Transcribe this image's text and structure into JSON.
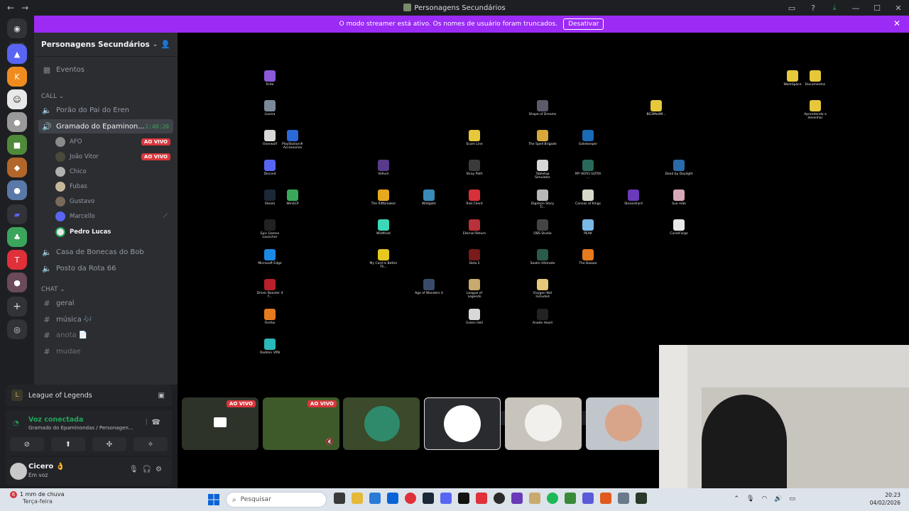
{
  "window": {
    "title": "Personagens Secundários",
    "back": "←",
    "forward": "→"
  },
  "streamer_banner": {
    "text": "O modo streamer está ativo. Os nomes de usuário foram truncados.",
    "button": "Desativar"
  },
  "guild": {
    "name": "Personagens Secundários"
  },
  "channels": {
    "events": "Eventos",
    "call_category": "CALL",
    "voice": [
      {
        "name": "Porão do Pai do Eren"
      },
      {
        "name": "Gramado do Epaminon...",
        "time": "1:40:20",
        "active": true
      },
      {
        "name": "Casa de Bonecas do Bob"
      },
      {
        "name": "Posto da Rota 66"
      }
    ],
    "members": [
      {
        "name": "AFO",
        "badge": "AO VIVO"
      },
      {
        "name": "João Vitor",
        "badge": "AO VIVO"
      },
      {
        "name": "Chico"
      },
      {
        "name": "Fubas"
      },
      {
        "name": "Gustavo"
      },
      {
        "name": "Marcello"
      },
      {
        "name": "Pedro Lucas"
      }
    ],
    "chat_category": "CHAT",
    "text": [
      {
        "name": "geral"
      },
      {
        "name": "música 🎶"
      },
      {
        "name": "anota 📄"
      },
      {
        "name": "mudae"
      }
    ]
  },
  "activity": {
    "game": "League of Legends"
  },
  "voice_panel": {
    "status": "Voz conectada",
    "location": "Gramado do Epaminondas / Personagen..."
  },
  "user_panel": {
    "name": "Cicero 👌",
    "status": "Em voz"
  },
  "stream_tiles": [
    {
      "live": "AO VIVO"
    },
    {
      "live": "AO VIVO"
    }
  ],
  "desktop_icons": [
    "Krita",
    "Lixeira",
    "Overwolf",
    "PlayStation® Accessories",
    "Discord",
    "Steam",
    "WinSCP",
    "Epic Games Launcher",
    "Microsoft Edge",
    "Driver Booster 4 f...",
    "Firefox",
    "Radmin VPN",
    "Vellum",
    "The Riftbreaker",
    "Wildfrost",
    "My Card Is Better Th...",
    "Wildgate",
    "Age of Wonders 4",
    "Scam Line",
    "Stray Path",
    "Riot Client",
    "Eternal Return",
    "Dota 2",
    "League of Legends",
    "Green Hell",
    "Shape of Dreams",
    "The Spell Brigade",
    "Tabletop Simulator",
    "Digimon Story Ti...",
    "OBS Studio",
    "Sealm Ultimate",
    "Oxygen Not Included",
    "Anode Heart",
    "Gatekeeper",
    "MY HERO ULTRA ...",
    "Canvas of Kings",
    "PEAK",
    "The Bazaar",
    "Stoneshard",
    "BG3ModM...",
    "Dead by Daylight",
    "Sua mãe",
    "CurseForge",
    "WorkSpace",
    "Documentos",
    "Aprendendo a desenhar"
  ],
  "taskbar": {
    "weather_badge": "6",
    "weather": "1 mm de chuva",
    "weather_day": "Terça-feira",
    "search_placeholder": "Pesquisar",
    "time": "20:23",
    "date": "04/02/2026"
  },
  "colors": {
    "accent": "#9b2bf5",
    "live": "#da373c",
    "connected": "#23a55a"
  }
}
